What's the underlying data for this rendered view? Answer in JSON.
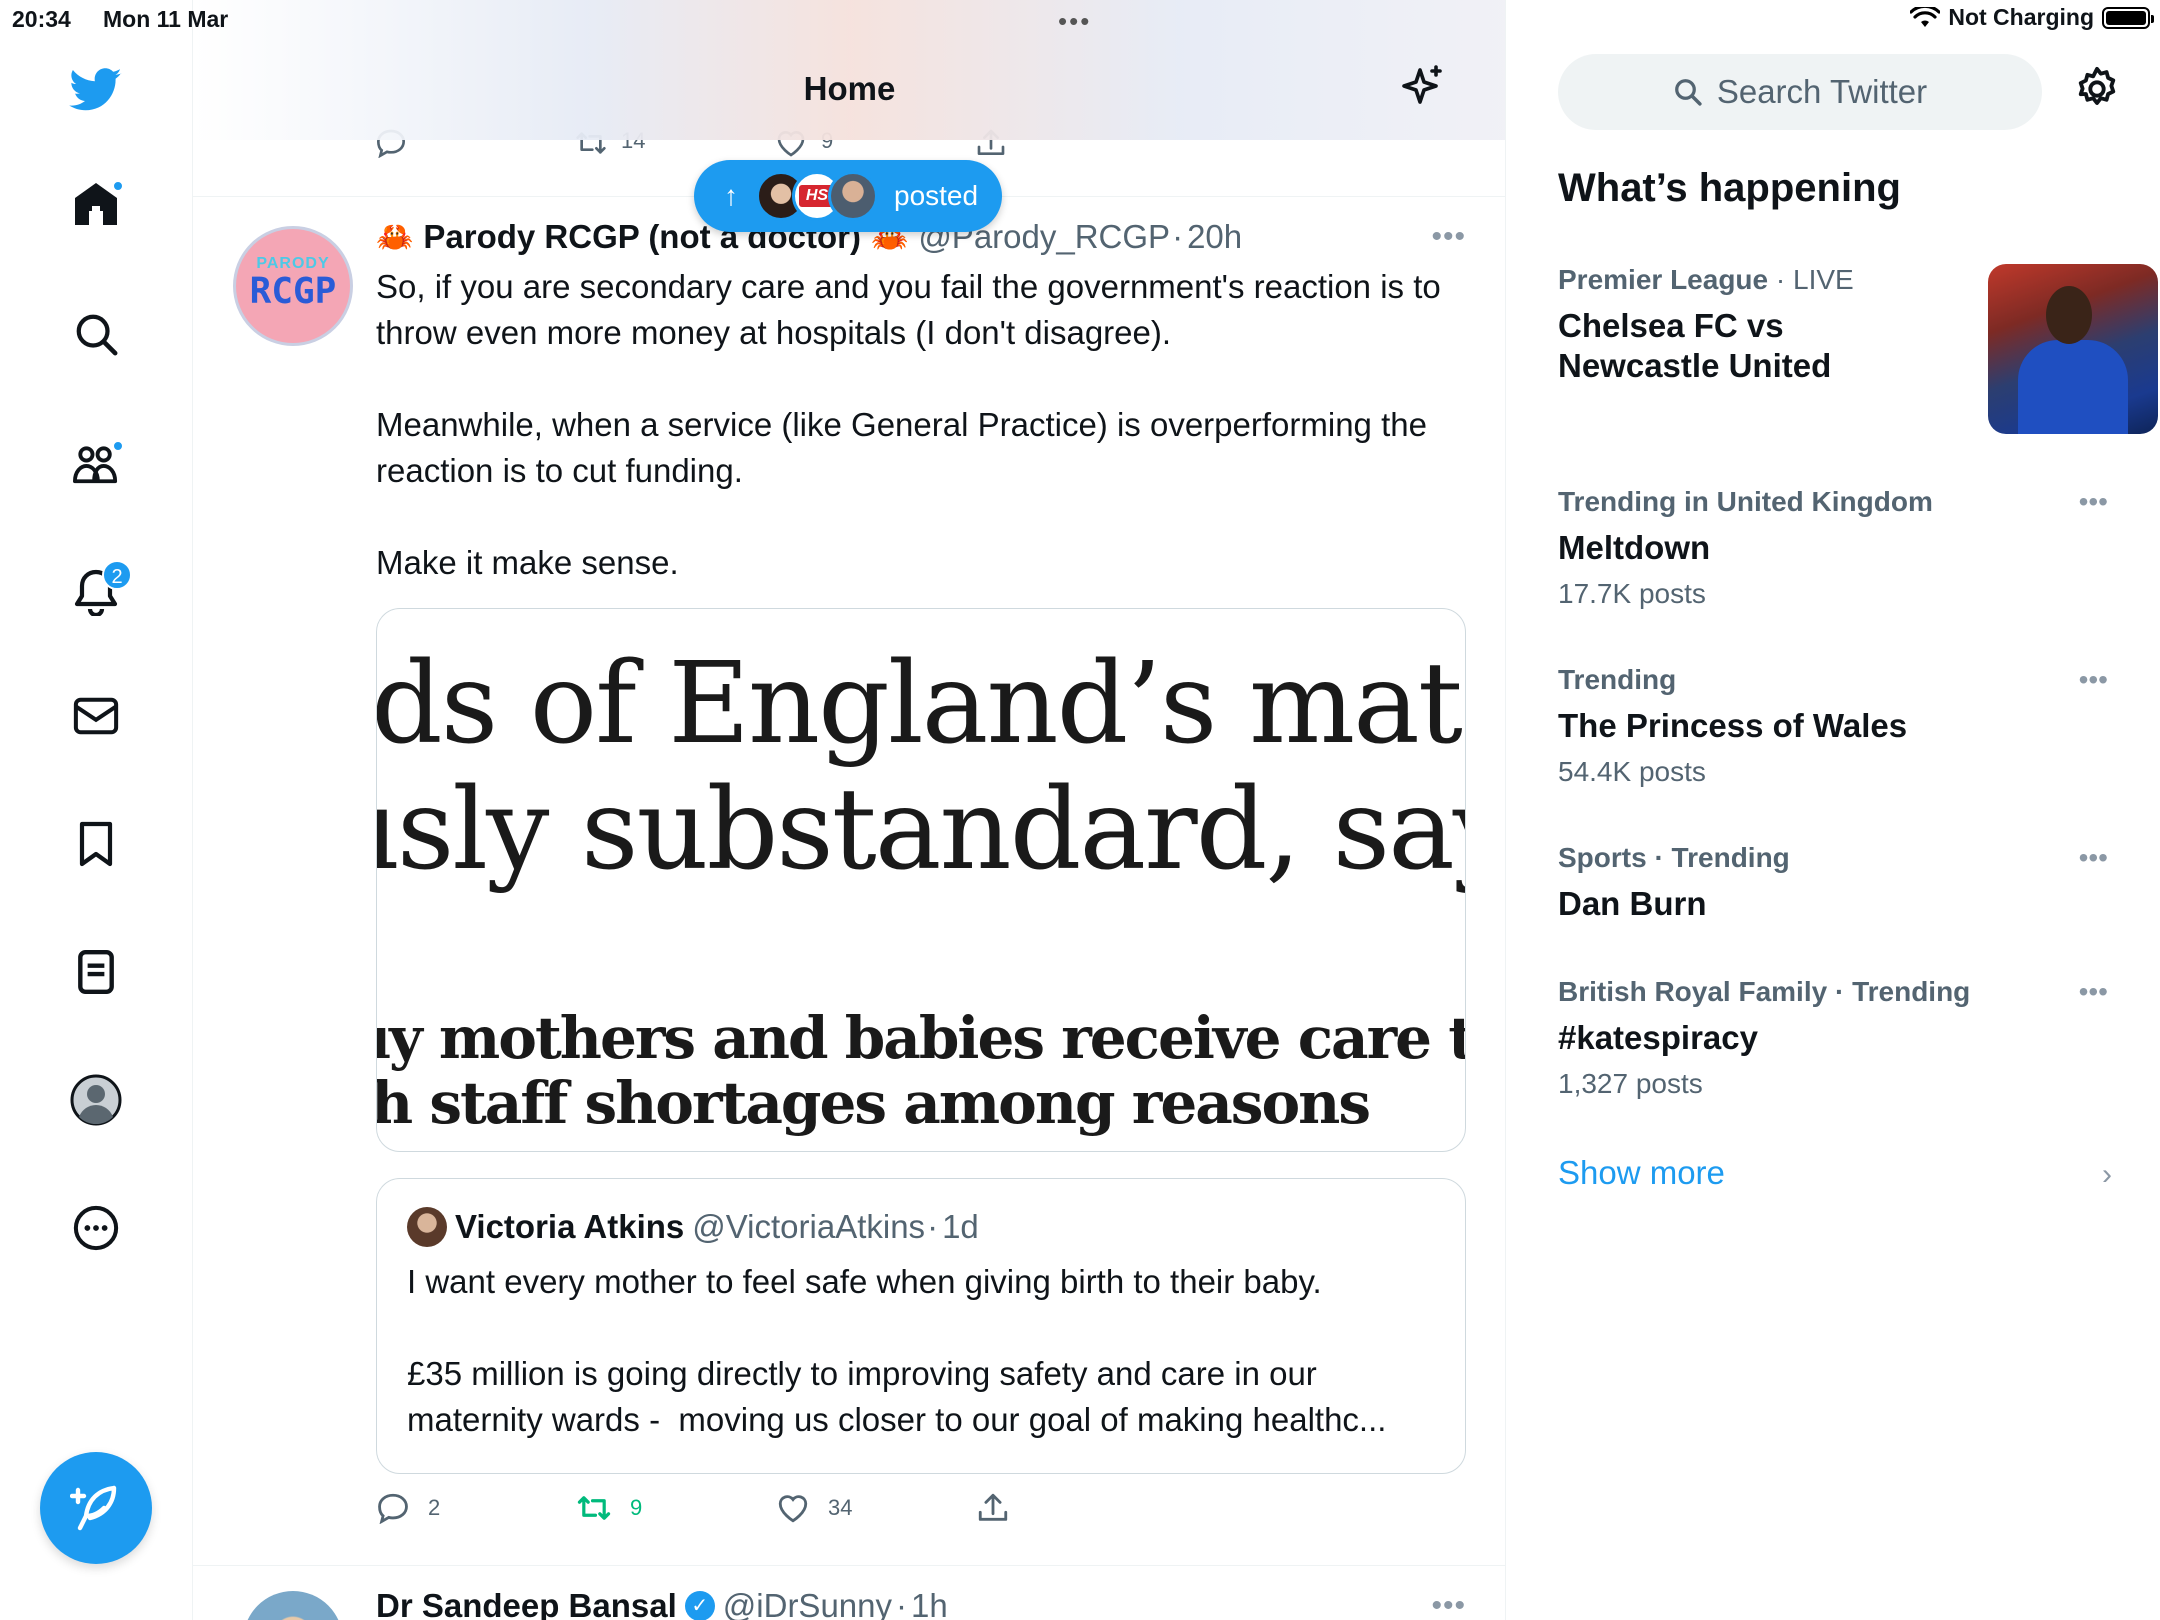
{
  "status_bar": {
    "time": "20:34",
    "date": "Mon 11 Mar",
    "multitask": "•••",
    "battery_label": "Not Charging"
  },
  "nav": {
    "items": [
      "home-icon",
      "explore-icon",
      "communities-icon",
      "notifications-icon",
      "messages-icon",
      "bookmarks-icon",
      "lists-icon",
      "profile-icon",
      "more-icon"
    ],
    "notifications_badge": "2"
  },
  "header": {
    "title": "Home"
  },
  "previous_tweet_actions": {
    "retweets": "14",
    "likes": "9"
  },
  "posted_pill": {
    "label": "posted",
    "arrow": "↑"
  },
  "tweet": {
    "avatar_top": "PARODY",
    "avatar_main": "RCGP",
    "name": "Parody RCGP (not a doctor)",
    "handle": "@Parody_RCGP",
    "separator": "·",
    "time": "20h",
    "emoji": "🦀",
    "text": "So, if you are secondary care and you fail the government's reaction is to throw even more money at hospitals (I don't disagree).\n\nMeanwhile, when a service (like General Practice) is overperforming the reaction is to cut funding.\n\nMake it make sense.",
    "media_lines": [
      "ds of England’s matern",
      "ısly substandard, says",
      "ıy mothers and babies receive care that is r",
      "h staff shortages among reasons"
    ],
    "quote": {
      "name": "Victoria Atkins",
      "handle": "@VictoriaAtkins",
      "separator": "·",
      "time": "1d",
      "text": "I want every mother to feel safe when giving birth to their baby.\n\n£35 million is going directly to improving safety and care in our maternity wards -  moving us closer to our goal of making healthc..."
    },
    "replies": "2",
    "retweets": "9",
    "likes": "34"
  },
  "next_tweet": {
    "name": "Dr Sandeep Bansal",
    "handle": "@iDrSunny",
    "separator": "·",
    "time": "1h"
  },
  "right": {
    "search_placeholder": "Search Twitter",
    "section_title": "What’s happening",
    "trends": [
      {
        "meta_a": "Premier League",
        "meta_sep": " · ",
        "meta_b": "LIVE",
        "title": "Chelsea FC vs Newcastle United",
        "count": ""
      },
      {
        "meta_a": "Trending in United Kingdom",
        "meta_sep": "",
        "meta_b": "",
        "title": "Meltdown",
        "count": "17.7K posts"
      },
      {
        "meta_a": "Trending",
        "meta_sep": "",
        "meta_b": "",
        "title": "The Princess of Wales",
        "count": "54.4K posts"
      },
      {
        "meta_a": "Sports · Trending",
        "meta_sep": "",
        "meta_b": "",
        "title": "Dan Burn",
        "count": ""
      },
      {
        "meta_a": "British Royal Family · Trending",
        "meta_sep": "",
        "meta_b": "",
        "title": "#katespiracy",
        "count": "1,327 posts"
      }
    ],
    "show_more": "Show more"
  },
  "colors": {
    "accent": "#1d9bf0",
    "retweet_green": "#00ba7c",
    "muted": "#536471"
  }
}
